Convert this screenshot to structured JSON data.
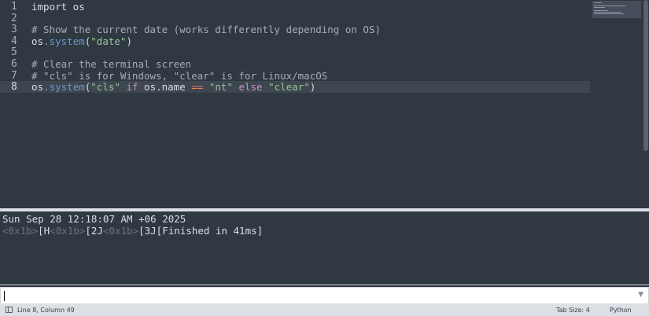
{
  "editor": {
    "line_numbers": [
      "1",
      "2",
      "3",
      "4",
      "5",
      "6",
      "7",
      "8"
    ],
    "lines": [
      [
        {
          "t": "import",
          "c": "pl"
        },
        {
          "t": " os",
          "c": "pl"
        }
      ],
      [],
      [
        {
          "t": "# Show the current date (works differently depending on OS)",
          "c": "cm"
        }
      ],
      [
        {
          "t": "os",
          "c": "pl"
        },
        {
          "t": ".",
          "c": "dot"
        },
        {
          "t": "system",
          "c": "fn"
        },
        {
          "t": "(",
          "c": "pl"
        },
        {
          "t": "\"date\"",
          "c": "st"
        },
        {
          "t": ")",
          "c": "pl"
        }
      ],
      [],
      [
        {
          "t": "# Clear the terminal screen",
          "c": "cm"
        }
      ],
      [
        {
          "t": "# \"cls\" is for Windows, \"clear\" is for Linux/macOS",
          "c": "cm"
        }
      ],
      [
        {
          "t": "os",
          "c": "pl"
        },
        {
          "t": ".",
          "c": "dot"
        },
        {
          "t": "system",
          "c": "fn"
        },
        {
          "t": "(",
          "c": "pl"
        },
        {
          "t": "\"cls\"",
          "c": "st"
        },
        {
          "t": " ",
          "c": "pl"
        },
        {
          "t": "if",
          "c": "kw"
        },
        {
          "t": " os.name ",
          "c": "pl"
        },
        {
          "t": "==",
          "c": "op"
        },
        {
          "t": " ",
          "c": "pl"
        },
        {
          "t": "\"nt\"",
          "c": "st"
        },
        {
          "t": " ",
          "c": "pl"
        },
        {
          "t": "else",
          "c": "kw"
        },
        {
          "t": " ",
          "c": "pl"
        },
        {
          "t": "\"clear\"",
          "c": "st"
        },
        {
          "t": ")",
          "c": "pl"
        }
      ]
    ],
    "active_line": 8
  },
  "output": {
    "line1": "Sun Sep 28 12:18:07 AM +06 2025",
    "line2": [
      {
        "t": "<0x1b>",
        "esc": true
      },
      {
        "t": "[H",
        "esc": false
      },
      {
        "t": "<0x1b>",
        "esc": true
      },
      {
        "t": "[2J",
        "esc": false
      },
      {
        "t": "<0x1b>",
        "esc": true
      },
      {
        "t": "[3J[Finished in 41ms]",
        "esc": false
      }
    ]
  },
  "command_bar": {
    "value": "",
    "arrow": "▼"
  },
  "status_bar": {
    "position": "Line 8, Column 49",
    "tab_size": "Tab Size: 4",
    "syntax": "Python",
    "panel_icon": "panel-toggle-icon"
  },
  "colors": {
    "editor_bg": "#303841",
    "keyword": "#c594c5",
    "comment": "#a7adba",
    "function": "#6699cc",
    "string": "#99c794",
    "operator": "#f97b58",
    "status_bg": "#dcdfe4"
  }
}
